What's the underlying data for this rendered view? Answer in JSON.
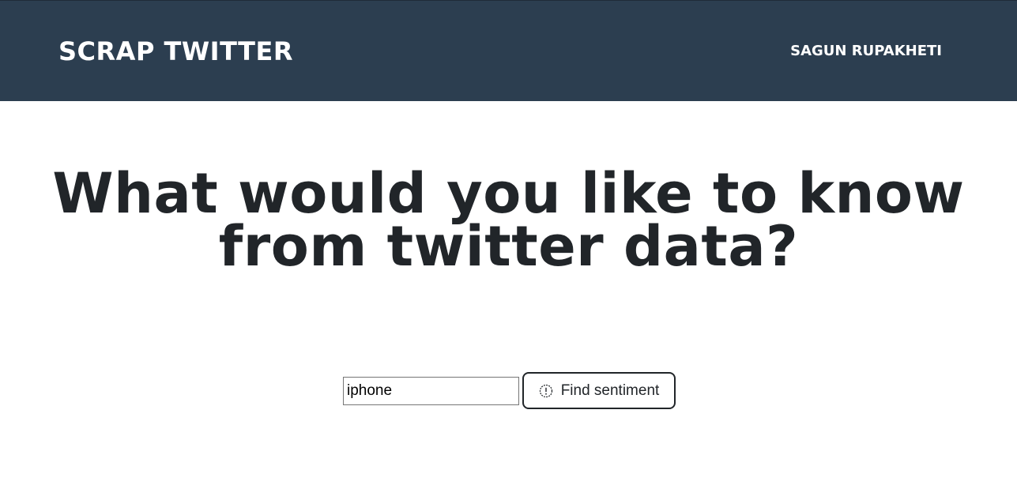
{
  "navbar": {
    "brand": "SCRAP TWITTER",
    "user": "SAGUN RUPAKHETI",
    "background_color": "#2c3e50"
  },
  "main": {
    "headline": "What would you like to know from twitter data?"
  },
  "search": {
    "value": "iphone",
    "button_label": "Find sentiment",
    "button_icon": "info-circle-icon"
  }
}
